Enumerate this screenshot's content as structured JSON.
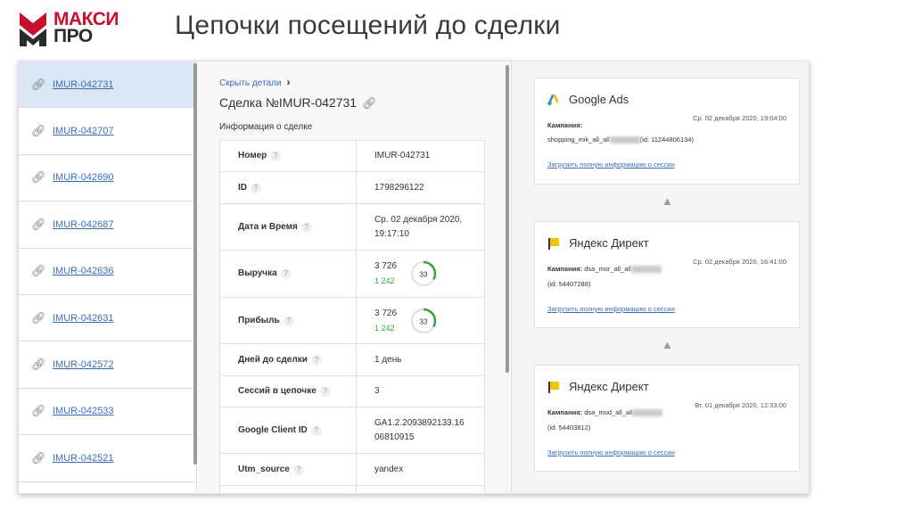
{
  "header": {
    "logo_line1": "МАКСИ",
    "logo_line2": "ПРО",
    "title": "Цепочки посещений до сделки"
  },
  "deals": [
    {
      "id": "IMUR-042731",
      "active": true
    },
    {
      "id": "IMUR-042707",
      "active": false
    },
    {
      "id": "IMUR-042690",
      "active": false
    },
    {
      "id": "IMUR-042687",
      "active": false
    },
    {
      "id": "IMUR-042636",
      "active": false
    },
    {
      "id": "IMUR-042631",
      "active": false
    },
    {
      "id": "IMUR-042572",
      "active": false
    },
    {
      "id": "IMUR-042533",
      "active": false
    },
    {
      "id": "IMUR-042521",
      "active": false
    }
  ],
  "details": {
    "hide_label": "Скрыть детали",
    "deal_title": "Сделка №IMUR-042731",
    "info_title": "Информация о сделке",
    "rows": {
      "number": {
        "label": "Номер",
        "value": "IMUR-042731"
      },
      "id": {
        "label": "ID",
        "value": "1798296122"
      },
      "datetime": {
        "label": "Дата и Время",
        "value_line1": "Ср. 02 декабря 2020,",
        "value_line2": "19:17:10"
      },
      "revenue": {
        "label": "Выручка",
        "value": "3 726",
        "sub": "1 242",
        "ring_value": "33"
      },
      "profit": {
        "label": "Прибыль",
        "value": "3 726",
        "sub": "1 242",
        "ring_value": "33"
      },
      "days": {
        "label": "Дней до сделки",
        "value": "1 день"
      },
      "sessions": {
        "label": "Сессий в цепочке",
        "value": "3"
      },
      "gcid": {
        "label": "Google Client ID",
        "value_line1": "GA1.2.2093892133.16",
        "value_line2": "06810915"
      },
      "utm_source": {
        "label": "Utm_source",
        "value": "yandex"
      }
    },
    "help_glyph": "?"
  },
  "sessions": [
    {
      "source": "Google Ads",
      "date": "Ср. 02 декабря 2020, 19:04:00",
      "campaign_label": "Кампания:",
      "campaign_line1": "shopping_mik_all_all",
      "campaign_id": "(id: 11244806134)",
      "load_link": "Загрузить полную информацию о сессии"
    },
    {
      "source": "Яндекс Директ",
      "date": "Ср. 02 декабря 2020, 16:41:00",
      "campaign_label": "Кампания:",
      "campaign_line1": "dsa_mor_all_all",
      "campaign_id": "(id: 54407288)",
      "load_link": "Загрузить полную информацию о сессии"
    },
    {
      "source": "Яндекс Директ",
      "date": "Вт. 01 декабря 2020, 12:33:00",
      "campaign_label": "Кампания:",
      "campaign_line1": "dsa_mod_all_all",
      "campaign_id": "(id: 54403812)",
      "load_link": "Загрузить полную информацию о сессии"
    }
  ],
  "colors": {
    "brand_red": "#c8102e",
    "link_blue": "#3b6fb6",
    "active_row": "#d9e6f6",
    "positive_green": "#3aa04a",
    "yandex_yellow": "#f5c400"
  },
  "icons": {
    "deal_link": "link-icon",
    "copy": "link-icon",
    "google_ads": "google-ads-icon",
    "yandex_direct": "yandex-direct-icon",
    "chain_arrow": "arrow-up-icon"
  }
}
